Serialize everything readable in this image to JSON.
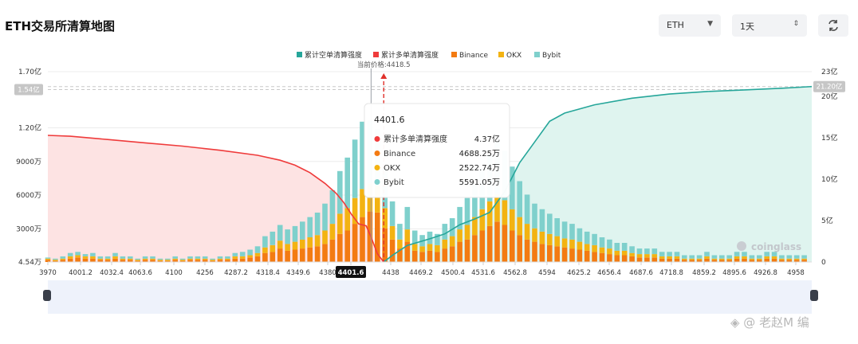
{
  "header": {
    "title": "ETH交易所清算地图",
    "coin_select": "ETH",
    "range_select": "1天"
  },
  "watermark": {
    "logo_text": "coinglass",
    "user_mark": "◈ @ 老赵M 编"
  },
  "colors": {
    "short_line": "#26a69a",
    "long_line": "#ef3b3b",
    "binance": "#f37b12",
    "okx": "#f3b312",
    "bybit": "#7fd0cc",
    "long_area": "#fde3e3",
    "short_area": "#dff4ef",
    "slider_bg": "#eef2fb"
  },
  "chart_data": {
    "type": "bar",
    "legend": [
      "累计空单清算强度",
      "累计多单清算强度",
      "Binance",
      "OKX",
      "Bybit"
    ],
    "legend_position": "top-center",
    "current_price_label": "当前价格:4418.5",
    "current_price": 4418.5,
    "x_ticks": [
      "3970",
      "4001.2",
      "4032.4",
      "4063.6",
      "4100",
      "4256",
      "4287.2",
      "4318.4",
      "4349.6",
      "4380",
      "4401.6",
      "4438",
      "4469.2",
      "4500.4",
      "4531.6",
      "4562.8",
      "4594",
      "4625.2",
      "4656.4",
      "4687.6",
      "4718.8",
      "4859.2",
      "4895.6",
      "4926.8",
      "4958"
    ],
    "x_range": [
      3970,
      4990
    ],
    "left_axis": {
      "ticks": [
        "4.54万",
        "3000万",
        "6000万",
        "9000万",
        "1.20亿",
        "1.70亿"
      ],
      "values": [
        454000,
        30000000,
        60000000,
        90000000,
        120000000,
        170000000
      ],
      "range": [
        454000,
        170000000
      ]
    },
    "right_axis": {
      "ticks": [
        "0",
        "5亿",
        "10亿",
        "15亿",
        "20亿",
        "23亿"
      ],
      "values": [
        0,
        500000000,
        1000000000,
        1500000000,
        2000000000,
        2300000000
      ],
      "range": [
        0,
        2300000000
      ]
    },
    "left_max_badge": "1.54亿",
    "left_max_value": 154000000,
    "right_max_badge": "21.20亿",
    "right_max_value": 2120000000,
    "highlighted_x_label": "4401.6",
    "highlighted_x": 4401.6,
    "tooltip": {
      "title": "4401.6",
      "rows": [
        {
          "name": "累计多单清算强度",
          "value": "4.37亿"
        },
        {
          "name": "Binance",
          "value": "4688.25万"
        },
        {
          "name": "OKX",
          "value": "2522.74万"
        },
        {
          "name": "Bybit",
          "value": "5591.05万"
        }
      ]
    },
    "long_cumulative": {
      "name": "累计多单清算强度",
      "x": [
        3970,
        4000,
        4050,
        4100,
        4150,
        4200,
        4250,
        4280,
        4300,
        4320,
        4340,
        4355,
        4365,
        4375,
        4385,
        4395,
        4401.6,
        4410,
        4418.5
      ],
      "y": [
        1530000000,
        1520000000,
        1480000000,
        1440000000,
        1400000000,
        1350000000,
        1290000000,
        1230000000,
        1170000000,
        1080000000,
        950000000,
        830000000,
        720000000,
        580000000,
        460000000,
        437000000,
        300000000,
        100000000,
        0
      ]
    },
    "short_cumulative": {
      "name": "累计空单清算强度",
      "x": [
        4418.5,
        4430,
        4450,
        4480,
        4500,
        4520,
        4540,
        4560,
        4580,
        4600,
        4620,
        4640,
        4660,
        4700,
        4750,
        4800,
        4850,
        4900,
        4950,
        4990
      ],
      "y": [
        0,
        80000000,
        200000000,
        280000000,
        340000000,
        450000000,
        520000000,
        600000000,
        850000000,
        1200000000,
        1450000000,
        1700000000,
        1800000000,
        1900000000,
        1980000000,
        2030000000,
        2060000000,
        2080000000,
        2100000000,
        2120000000
      ]
    },
    "bars": {
      "x": [
        3970,
        3980,
        3990,
        4000,
        4010,
        4020,
        4030,
        4040,
        4050,
        4060,
        4070,
        4080,
        4090,
        4100,
        4110,
        4120,
        4130,
        4140,
        4150,
        4160,
        4170,
        4180,
        4190,
        4200,
        4210,
        4220,
        4230,
        4240,
        4250,
        4260,
        4270,
        4280,
        4290,
        4300,
        4310,
        4320,
        4330,
        4340,
        4350,
        4360,
        4370,
        4380,
        4390,
        4400,
        4410,
        4420,
        4430,
        4440,
        4450,
        4460,
        4470,
        4480,
        4490,
        4500,
        4510,
        4520,
        4530,
        4540,
        4550,
        4560,
        4570,
        4580,
        4590,
        4600,
        4610,
        4620,
        4630,
        4640,
        4650,
        4660,
        4670,
        4680,
        4690,
        4700,
        4710,
        4720,
        4730,
        4740,
        4750,
        4760,
        4770,
        4780,
        4790,
        4800,
        4810,
        4820,
        4830,
        4840,
        4850,
        4860,
        4870,
        4880,
        4890,
        4900,
        4910,
        4920,
        4930,
        4940,
        4950,
        4960,
        4970,
        4980
      ],
      "binance": [
        2,
        1,
        2,
        3,
        4,
        3,
        3,
        2,
        2,
        3,
        2,
        2,
        1,
        2,
        2,
        1,
        1,
        2,
        1,
        2,
        2,
        2,
        1,
        2,
        2,
        3,
        3,
        4,
        5,
        8,
        9,
        12,
        10,
        11,
        12,
        13,
        14,
        16,
        20,
        25,
        28,
        34,
        40,
        45,
        44,
        30,
        20,
        12,
        18,
        10,
        9,
        10,
        9,
        12,
        14,
        18,
        20,
        24,
        28,
        32,
        36,
        33,
        28,
        24,
        20,
        18,
        16,
        15,
        14,
        13,
        12,
        11,
        10,
        9,
        8,
        7,
        6,
        6,
        5,
        4,
        4,
        4,
        3,
        3,
        3,
        2,
        2,
        2,
        3,
        2,
        2,
        2,
        3,
        3,
        2,
        2,
        3,
        3,
        2,
        2,
        2,
        2
      ],
      "okx": [
        1,
        1,
        1,
        2,
        2,
        2,
        2,
        1,
        1,
        2,
        1,
        1,
        1,
        1,
        1,
        1,
        1,
        1,
        1,
        1,
        1,
        1,
        1,
        1,
        1,
        2,
        2,
        2,
        3,
        5,
        6,
        7,
        6,
        7,
        8,
        9,
        10,
        12,
        14,
        18,
        20,
        23,
        25,
        25,
        24,
        18,
        12,
        8,
        11,
        6,
        5,
        6,
        6,
        8,
        9,
        11,
        13,
        16,
        19,
        22,
        24,
        22,
        19,
        16,
        14,
        12,
        11,
        10,
        9,
        8,
        8,
        7,
        6,
        6,
        5,
        5,
        4,
        4,
        3,
        3,
        3,
        3,
        2,
        2,
        2,
        1,
        1,
        1,
        2,
        1,
        1,
        1,
        2,
        2,
        1,
        1,
        2,
        2,
        1,
        1,
        1,
        1
      ],
      "bybit": [
        1,
        1,
        2,
        3,
        3,
        2,
        3,
        2,
        2,
        3,
        2,
        2,
        1,
        2,
        2,
        1,
        1,
        2,
        1,
        2,
        2,
        2,
        1,
        2,
        2,
        3,
        4,
        5,
        6,
        10,
        12,
        14,
        13,
        14,
        16,
        18,
        20,
        24,
        30,
        38,
        45,
        52,
        60,
        56,
        50,
        35,
        22,
        14,
        20,
        12,
        10,
        11,
        10,
        14,
        16,
        20,
        24,
        30,
        36,
        42,
        48,
        44,
        38,
        32,
        26,
        22,
        20,
        18,
        16,
        15,
        14,
        12,
        11,
        10,
        9,
        8,
        7,
        7,
        6,
        5,
        5,
        5,
        4,
        4,
        4,
        3,
        3,
        3,
        4,
        3,
        3,
        3,
        4,
        4,
        3,
        3,
        4,
        4,
        3,
        3,
        3,
        3
      ]
    }
  }
}
